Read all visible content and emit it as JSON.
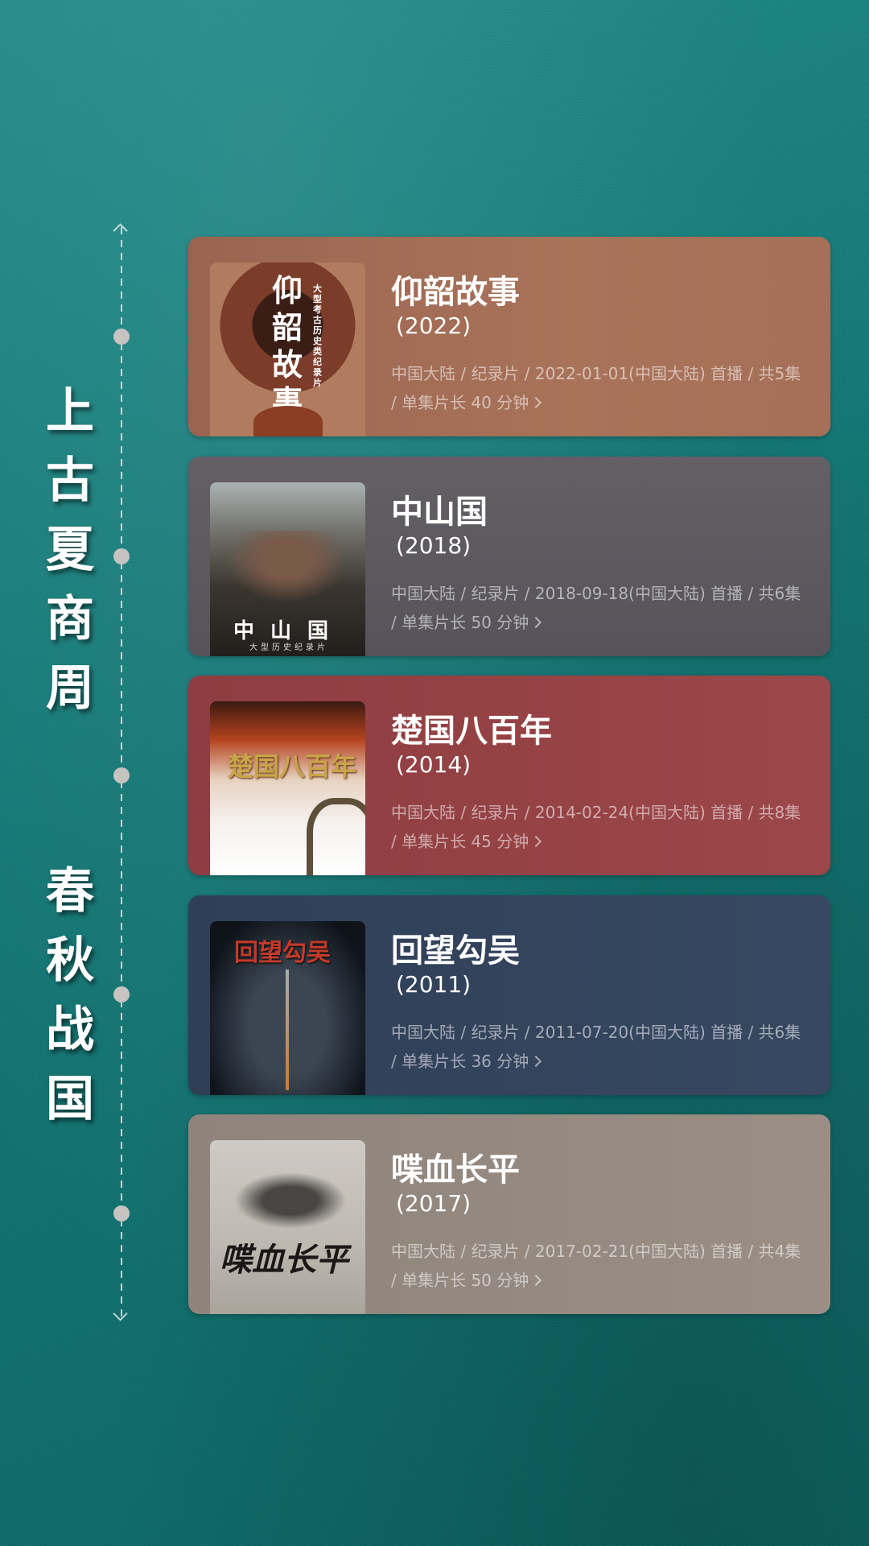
{
  "eras": [
    {
      "chars": [
        "上",
        "古",
        "夏",
        "商",
        "周"
      ]
    },
    {
      "chars": [
        "春",
        "秋",
        "战",
        "国"
      ]
    }
  ],
  "cards": [
    {
      "title": "仰韶故事",
      "year": "(2022)",
      "meta": "中国大陆 / 纪录片 / 2022-01-01(中国大陆) 首播 / 共5集 / 单集片长 40 分钟",
      "poster_text": "仰韶故事",
      "poster_sub": "大型考古历史类纪录片",
      "color": "#a56e55"
    },
    {
      "title": "中山国",
      "year": "(2018)",
      "meta": "中国大陆 / 纪录片 / 2018-09-18(中国大陆) 首播 / 共6集 / 单集片长 50 分钟",
      "poster_text": "中山国",
      "poster_sub": "大型历史纪录片",
      "color": "#5e5a5d"
    },
    {
      "title": "楚国八百年",
      "year": "(2014)",
      "meta": "中国大陆 / 纪录片 / 2014-02-24(中国大陆) 首播 / 共8集 / 单集片长 45 分钟",
      "poster_text": "楚国八百年",
      "poster_sub": "",
      "color": "#9a4548"
    },
    {
      "title": "回望勾吴",
      "year": "(2011)",
      "meta": "中国大陆 / 纪录片 / 2011-07-20(中国大陆) 首播 / 共6集 / 单集片长 36 分钟",
      "poster_text": "回望勾吴",
      "poster_sub": "",
      "color": "#36475e"
    },
    {
      "title": "喋血长平",
      "year": "(2017)",
      "meta": "中国大陆 / 纪录片 / 2017-02-21(中国大陆) 首播 / 共4集 / 单集片长 50 分钟",
      "poster_text": "喋血长平",
      "poster_sub": "",
      "color": "#978a80"
    }
  ]
}
